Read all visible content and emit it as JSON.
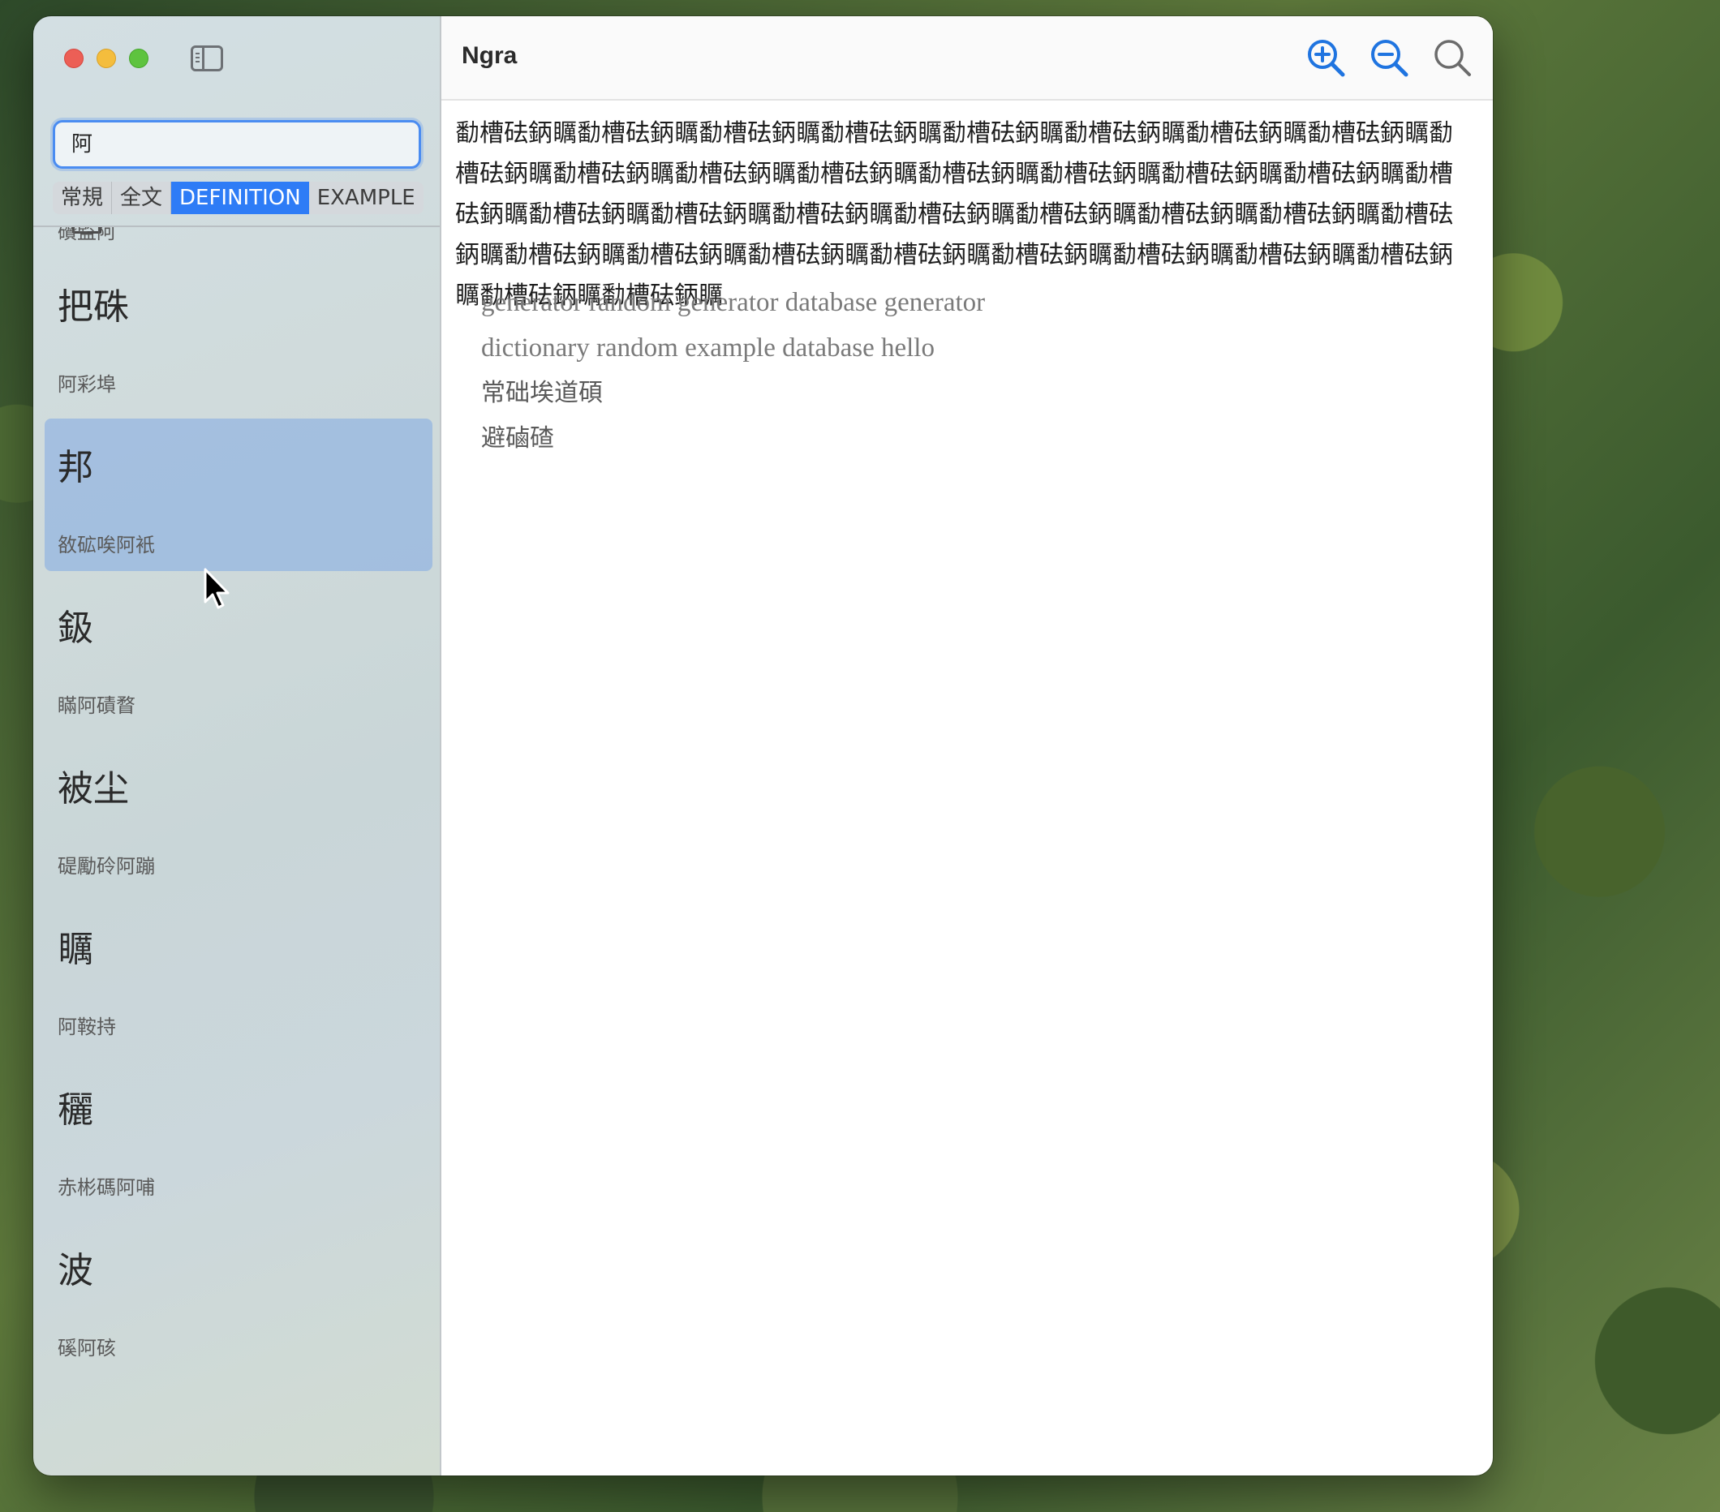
{
  "window": {
    "title": "Ngra"
  },
  "sidebar": {
    "search": {
      "value": "阿",
      "placeholder": ""
    },
    "tabs": [
      {
        "label": "常規",
        "active": false
      },
      {
        "label": "全文",
        "active": false
      },
      {
        "label": "DEFINITION",
        "active": true
      },
      {
        "label": "EXAMPLE",
        "active": false
      }
    ],
    "items": [
      {
        "head": "",
        "sub": "礸監阿"
      },
      {
        "head": "把硃",
        "sub": "阿彩埠"
      },
      {
        "head": "邦",
        "sub": "敋砿唉阿衹",
        "selected": true
      },
      {
        "head": "鈒",
        "sub": "瞞阿磧瞀"
      },
      {
        "head": "被尘",
        "sub": "碮勵砱阿蹦"
      },
      {
        "head": "矋",
        "sub": "阿鞍持"
      },
      {
        "head": "穲",
        "sub": "赤彬碼阿哺"
      },
      {
        "head": "波",
        "sub": "磎阿硋"
      }
    ]
  },
  "content": {
    "definition": "勫槽砝鈵矋勫槽砝鈵矋勫槽砝鈵矋勫槽砝鈵矋勫槽砝鈵矋勫槽砝鈵矋勫槽砝鈵矋勫槽砝鈵矋勫槽砝鈵矋勫槽砝鈵矋勫槽砝鈵矋勫槽砝鈵矋勫槽砝鈵矋勫槽砝鈵矋勫槽砝鈵矋勫槽砝鈵矋勫槽砝鈵矋勫槽砝鈵矋勫槽砝鈵矋勫槽砝鈵矋勫槽砝鈵矋勫槽砝鈵矋勫槽砝鈵矋勫槽砝鈵矋勫槽砝鈵矋勫槽砝鈵矋勫槽砝鈵矋勫槽砝鈵矋勫槽砝鈵矋勫槽砝鈵矋勫槽砝鈵矋勫槽砝鈵矋勫槽砝鈵矋勫槽砝鈵矋勫槽砝鈵矋",
    "examples": [
      "generator random generator database generator",
      "dictionary random example database hello",
      "常础埃道碩",
      "避磠碴"
    ]
  },
  "colors": {
    "accent": "#2e7cf6",
    "selection": "#8cb0e2",
    "icon_blue": "#1f74e0",
    "icon_gray": "#6b6b6b"
  },
  "icons": {
    "zoom_in": "zoom-in-icon",
    "zoom_out": "zoom-out-icon",
    "search": "search-icon",
    "sidebar_toggle": "sidebar-toggle-icon"
  }
}
